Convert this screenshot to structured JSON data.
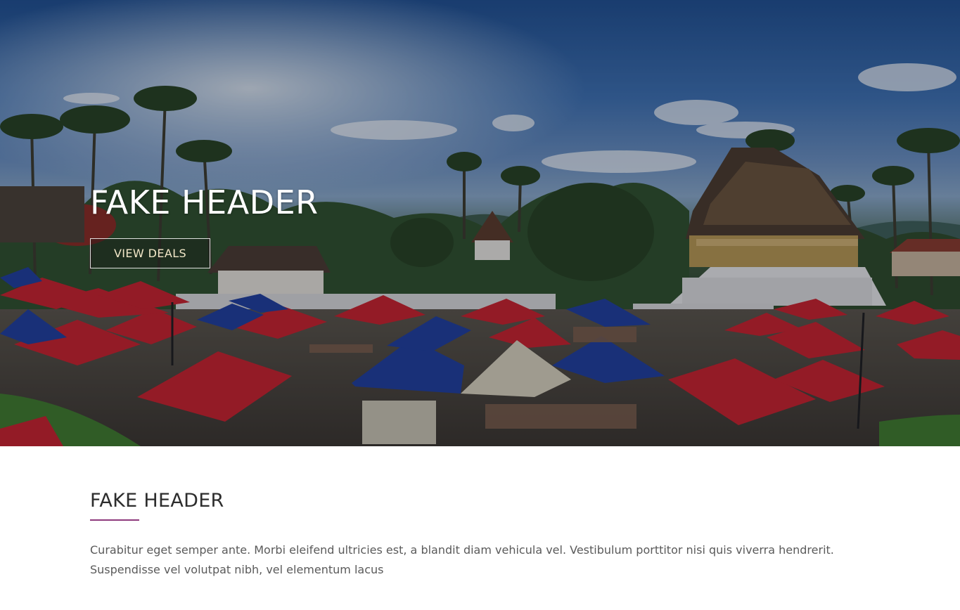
{
  "hero": {
    "title": "FAKE HEADER",
    "button_label": "VIEW DEALS"
  },
  "section": {
    "title": "FAKE HEADER",
    "body": "Curabitur eget semper ante. Morbi eleifend ultricies est, a blandit diam vehicula vel. Vestibulum porttitor nisi quis viverra hendrerit. Suspendisse vel volutpat nibh, vel elementum lacus"
  },
  "colors": {
    "accent_underline": "#8e3a7d",
    "tent_red": "#c8202a",
    "tent_blue": "#1f3d9c"
  }
}
